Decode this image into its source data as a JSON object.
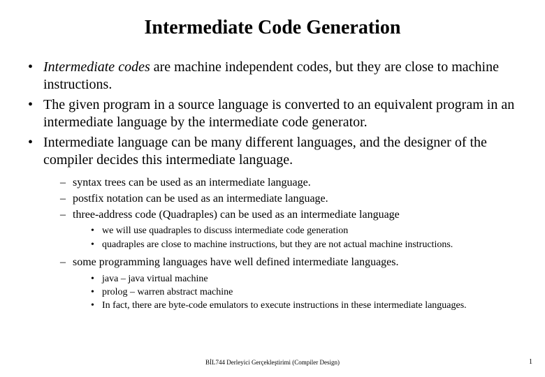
{
  "title": "Intermediate Code Generation",
  "bullets": [
    {
      "emphasis": "Intermediate codes",
      "rest": " are machine independent codes, but they are close to machine instructions."
    },
    {
      "text": "The given program in a source language is converted to an     equivalent program in an intermediate language by the intermediate code generator."
    },
    {
      "text": "Intermediate language can be many different languages, and the designer of the compiler decides this intermediate language."
    }
  ],
  "sub": [
    {
      "text": "syntax trees can be used as an intermediate language."
    },
    {
      "text": "postfix notation can be used as an intermediate language."
    },
    {
      "text": "three-address code (Quadraples) can be used as an intermediate language"
    }
  ],
  "sub3a": [
    {
      "text": "we will use quadraples to discuss intermediate code generation"
    },
    {
      "text": "quadraples are close to machine instructions, but they are not actual machine instructions."
    }
  ],
  "sub4": {
    "text": "some programming languages have well defined intermediate languages."
  },
  "sub3b": [
    {
      "text": "java – java virtual machine"
    },
    {
      "text": "prolog – warren abstract machine"
    },
    {
      "text": "In fact, there are byte-code emulators to execute instructions in these intermediate languages."
    }
  ],
  "footer": "BİL744 Derleyici Gerçekleştirimi (Compiler Design)",
  "pageNumber": "1"
}
